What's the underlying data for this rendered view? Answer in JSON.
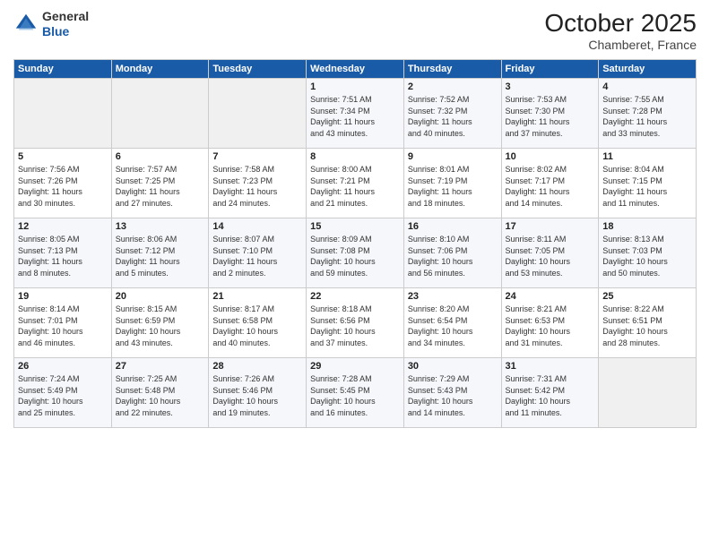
{
  "header": {
    "logo_general": "General",
    "logo_blue": "Blue",
    "month_title": "October 2025",
    "location": "Chamberet, France"
  },
  "days_of_week": [
    "Sunday",
    "Monday",
    "Tuesday",
    "Wednesday",
    "Thursday",
    "Friday",
    "Saturday"
  ],
  "weeks": [
    [
      {
        "day": "",
        "info": ""
      },
      {
        "day": "",
        "info": ""
      },
      {
        "day": "",
        "info": ""
      },
      {
        "day": "1",
        "info": "Sunrise: 7:51 AM\nSunset: 7:34 PM\nDaylight: 11 hours\nand 43 minutes."
      },
      {
        "day": "2",
        "info": "Sunrise: 7:52 AM\nSunset: 7:32 PM\nDaylight: 11 hours\nand 40 minutes."
      },
      {
        "day": "3",
        "info": "Sunrise: 7:53 AM\nSunset: 7:30 PM\nDaylight: 11 hours\nand 37 minutes."
      },
      {
        "day": "4",
        "info": "Sunrise: 7:55 AM\nSunset: 7:28 PM\nDaylight: 11 hours\nand 33 minutes."
      }
    ],
    [
      {
        "day": "5",
        "info": "Sunrise: 7:56 AM\nSunset: 7:26 PM\nDaylight: 11 hours\nand 30 minutes."
      },
      {
        "day": "6",
        "info": "Sunrise: 7:57 AM\nSunset: 7:25 PM\nDaylight: 11 hours\nand 27 minutes."
      },
      {
        "day": "7",
        "info": "Sunrise: 7:58 AM\nSunset: 7:23 PM\nDaylight: 11 hours\nand 24 minutes."
      },
      {
        "day": "8",
        "info": "Sunrise: 8:00 AM\nSunset: 7:21 PM\nDaylight: 11 hours\nand 21 minutes."
      },
      {
        "day": "9",
        "info": "Sunrise: 8:01 AM\nSunset: 7:19 PM\nDaylight: 11 hours\nand 18 minutes."
      },
      {
        "day": "10",
        "info": "Sunrise: 8:02 AM\nSunset: 7:17 PM\nDaylight: 11 hours\nand 14 minutes."
      },
      {
        "day": "11",
        "info": "Sunrise: 8:04 AM\nSunset: 7:15 PM\nDaylight: 11 hours\nand 11 minutes."
      }
    ],
    [
      {
        "day": "12",
        "info": "Sunrise: 8:05 AM\nSunset: 7:13 PM\nDaylight: 11 hours\nand 8 minutes."
      },
      {
        "day": "13",
        "info": "Sunrise: 8:06 AM\nSunset: 7:12 PM\nDaylight: 11 hours\nand 5 minutes."
      },
      {
        "day": "14",
        "info": "Sunrise: 8:07 AM\nSunset: 7:10 PM\nDaylight: 11 hours\nand 2 minutes."
      },
      {
        "day": "15",
        "info": "Sunrise: 8:09 AM\nSunset: 7:08 PM\nDaylight: 10 hours\nand 59 minutes."
      },
      {
        "day": "16",
        "info": "Sunrise: 8:10 AM\nSunset: 7:06 PM\nDaylight: 10 hours\nand 56 minutes."
      },
      {
        "day": "17",
        "info": "Sunrise: 8:11 AM\nSunset: 7:05 PM\nDaylight: 10 hours\nand 53 minutes."
      },
      {
        "day": "18",
        "info": "Sunrise: 8:13 AM\nSunset: 7:03 PM\nDaylight: 10 hours\nand 50 minutes."
      }
    ],
    [
      {
        "day": "19",
        "info": "Sunrise: 8:14 AM\nSunset: 7:01 PM\nDaylight: 10 hours\nand 46 minutes."
      },
      {
        "day": "20",
        "info": "Sunrise: 8:15 AM\nSunset: 6:59 PM\nDaylight: 10 hours\nand 43 minutes."
      },
      {
        "day": "21",
        "info": "Sunrise: 8:17 AM\nSunset: 6:58 PM\nDaylight: 10 hours\nand 40 minutes."
      },
      {
        "day": "22",
        "info": "Sunrise: 8:18 AM\nSunset: 6:56 PM\nDaylight: 10 hours\nand 37 minutes."
      },
      {
        "day": "23",
        "info": "Sunrise: 8:20 AM\nSunset: 6:54 PM\nDaylight: 10 hours\nand 34 minutes."
      },
      {
        "day": "24",
        "info": "Sunrise: 8:21 AM\nSunset: 6:53 PM\nDaylight: 10 hours\nand 31 minutes."
      },
      {
        "day": "25",
        "info": "Sunrise: 8:22 AM\nSunset: 6:51 PM\nDaylight: 10 hours\nand 28 minutes."
      }
    ],
    [
      {
        "day": "26",
        "info": "Sunrise: 7:24 AM\nSunset: 5:49 PM\nDaylight: 10 hours\nand 25 minutes."
      },
      {
        "day": "27",
        "info": "Sunrise: 7:25 AM\nSunset: 5:48 PM\nDaylight: 10 hours\nand 22 minutes."
      },
      {
        "day": "28",
        "info": "Sunrise: 7:26 AM\nSunset: 5:46 PM\nDaylight: 10 hours\nand 19 minutes."
      },
      {
        "day": "29",
        "info": "Sunrise: 7:28 AM\nSunset: 5:45 PM\nDaylight: 10 hours\nand 16 minutes."
      },
      {
        "day": "30",
        "info": "Sunrise: 7:29 AM\nSunset: 5:43 PM\nDaylight: 10 hours\nand 14 minutes."
      },
      {
        "day": "31",
        "info": "Sunrise: 7:31 AM\nSunset: 5:42 PM\nDaylight: 10 hours\nand 11 minutes."
      },
      {
        "day": "",
        "info": ""
      }
    ]
  ]
}
